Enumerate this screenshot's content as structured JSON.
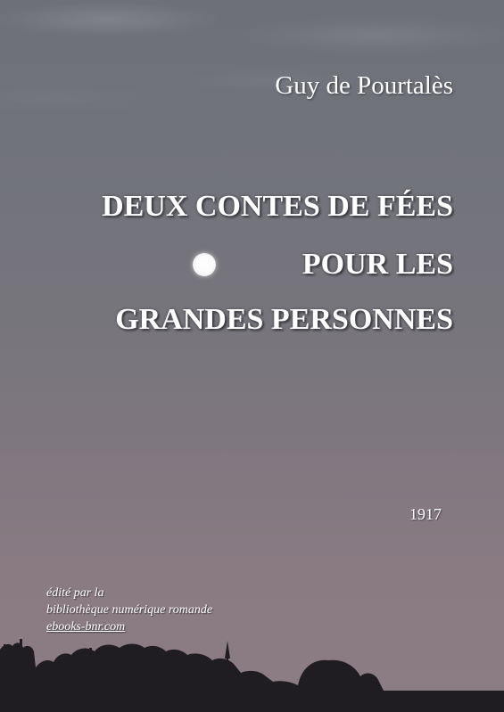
{
  "cover": {
    "author": "Guy de Pourtalès",
    "title_lines": [
      "DEUX CONTES DE FÉES",
      "POUR LES",
      "GRANDES PERSONNES"
    ],
    "year": "1917",
    "editor_lines": [
      "édité par la",
      "bibliothèque numérique romande"
    ],
    "editor_link": "ebooks-bnr.com"
  },
  "icons": {
    "moon": "moon-icon",
    "trees": "tree-silhouette-icon"
  },
  "colors": {
    "text": "#ffffff",
    "sky_top": "#6d7079",
    "sky_bottom": "#8c7d84",
    "silhouette": "#1f1d22"
  }
}
